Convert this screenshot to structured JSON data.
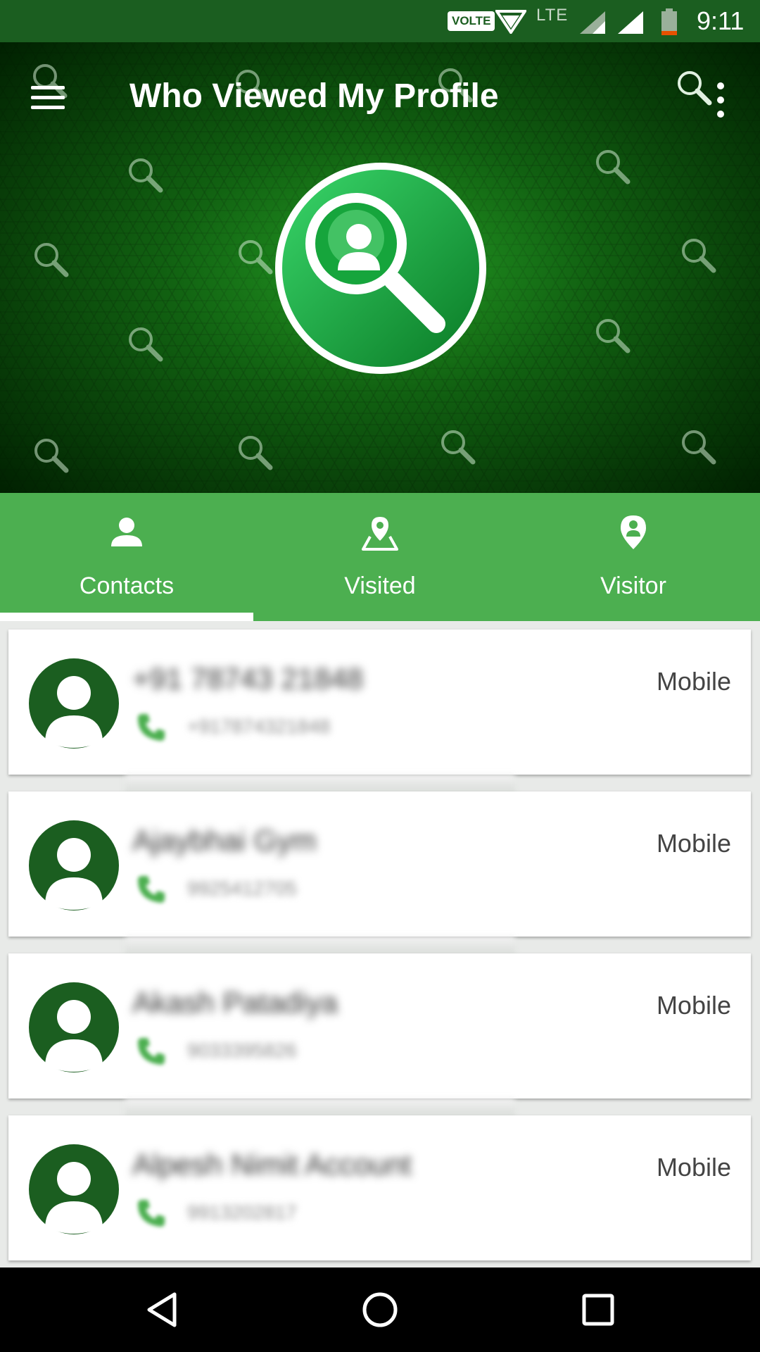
{
  "status_bar": {
    "volte": "VOLTE",
    "network": "LTE",
    "time": "9:11"
  },
  "app": {
    "title": "Who Viewed My Profile"
  },
  "tabs": [
    {
      "label": "Contacts",
      "icon": "person-icon",
      "selected": true
    },
    {
      "label": "Visited",
      "icon": "map-pin-icon",
      "selected": false
    },
    {
      "label": "Visitor",
      "icon": "location-person-icon",
      "selected": false
    }
  ],
  "contacts": [
    {
      "name": "+91 78743 21848",
      "number": "+917874321848",
      "type": "Mobile"
    },
    {
      "name": "Ajaybhai Gym",
      "number": "9925412705",
      "type": "Mobile"
    },
    {
      "name": "Akash Patadiya",
      "number": "9033395826",
      "type": "Mobile"
    },
    {
      "name": "Alpesh Nimit Account",
      "number": "9913202817",
      "type": "Mobile"
    }
  ],
  "colors": {
    "status_bar": "#1b5e20",
    "tab_bar": "#4caf50",
    "avatar": "#1b5e20",
    "phone_icon": "#4caf50"
  }
}
